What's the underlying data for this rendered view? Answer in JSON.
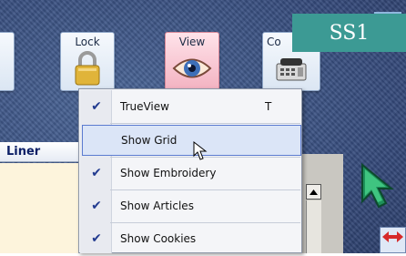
{
  "toolbar": {
    "lock_label": "Lock",
    "view_label": "View",
    "con_label": "Co",
    "icons": {
      "lock": "padlock-icon",
      "view": "eye-icon",
      "con": "telephone-icon"
    }
  },
  "badge": {
    "text": "SS1",
    "color": "#3c9a94"
  },
  "panel": {
    "title": "Liner"
  },
  "menu": {
    "items": [
      {
        "label": "TrueView",
        "checked": true,
        "shortcut": "T"
      },
      {
        "label": "Show Grid",
        "checked": false,
        "shortcut": "",
        "highlighted": true
      },
      {
        "label": "Show Embroidery",
        "checked": true,
        "shortcut": ""
      },
      {
        "label": "Show Articles",
        "checked": true,
        "shortcut": ""
      },
      {
        "label": "Show Cookies",
        "checked": true,
        "shortcut": ""
      }
    ],
    "check_glyph": "✔"
  },
  "colors": {
    "background": "#3d5685",
    "highlight": "#dbe5f7",
    "panel": "#fdf4dc"
  }
}
